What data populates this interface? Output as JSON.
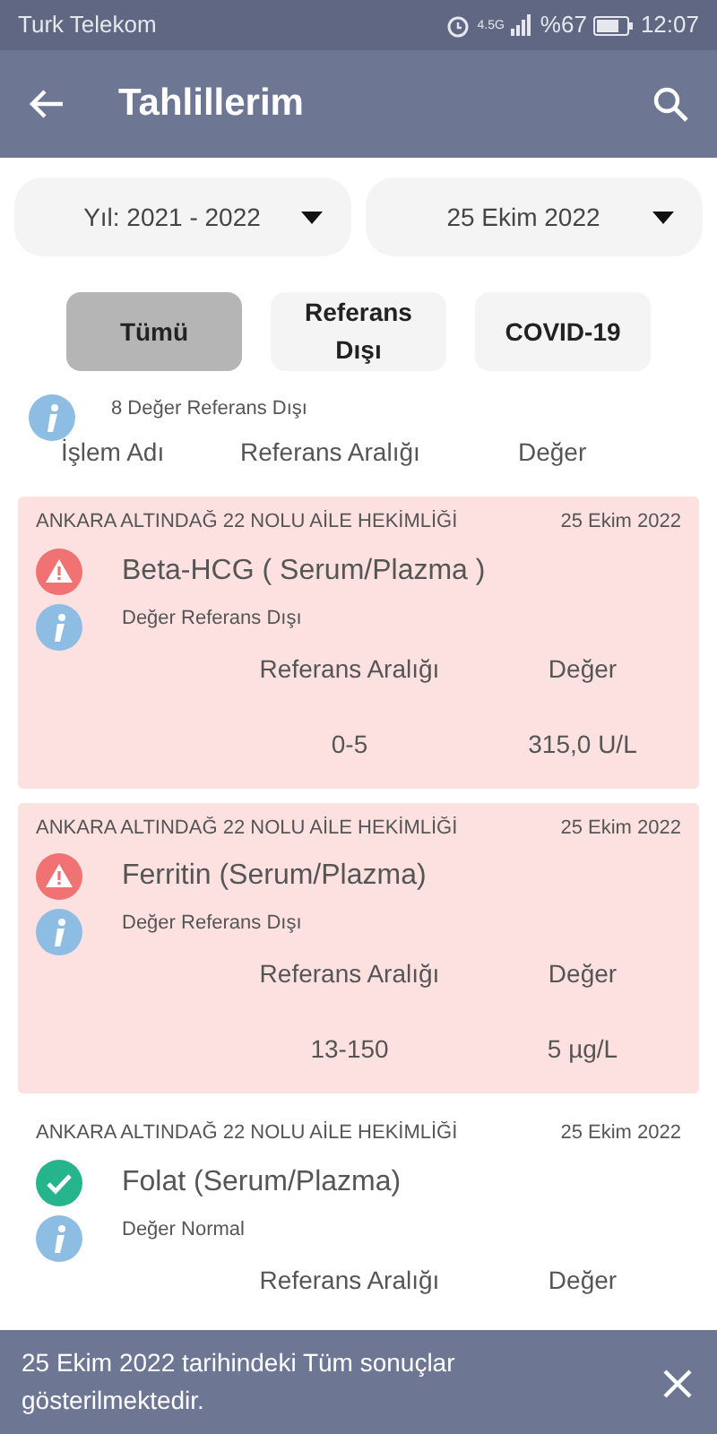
{
  "status_bar": {
    "carrier": "Turk Telekom",
    "network": "4.5G",
    "battery": "%67",
    "time": "12:07"
  },
  "app_bar": {
    "title": "Tahlillerim"
  },
  "dropdowns": [
    {
      "value": "Yıl: 2021 - 2022"
    },
    {
      "value": "25 Ekim 2022"
    }
  ],
  "filters": [
    {
      "label": "Tümü",
      "selected": true
    },
    {
      "label": "Referans Dışı",
      "selected": false
    },
    {
      "label": "COVID-19",
      "selected": false
    }
  ],
  "summary": "8 Değer Referans Dışı",
  "columns": [
    "İşlem Adı",
    "Referans Aralığı",
    "Değer"
  ],
  "results": [
    {
      "kind": "out",
      "institution": "ANKARA ALTINDAĞ 22 NOLU AİLE HEKİMLİĞİ",
      "date": "25 Ekim 2022",
      "name": "Beta-HCG ( Serum/Plazma )",
      "note": "Değer Referans Dışı",
      "range_label": "Referans Aralığı",
      "value_label": "Değer",
      "range": "0-5",
      "value": "315,0 U/L"
    },
    {
      "kind": "out",
      "institution": "ANKARA ALTINDAĞ 22 NOLU AİLE HEKİMLİĞİ",
      "date": "25 Ekim 2022",
      "name": "Ferritin (Serum/Plazma)",
      "note": "Değer Referans Dışı",
      "range_label": "Referans Aralığı",
      "value_label": "Değer",
      "range": "13-150",
      "value": "5 µg/L"
    },
    {
      "kind": "normal",
      "institution": "ANKARA ALTINDAĞ 22 NOLU AİLE HEKİMLİĞİ",
      "date": "25 Ekim 2022",
      "name": "Folat (Serum/Plazma)",
      "note": "Değer Normal",
      "range_label": "Referans Aralığı",
      "value_label": "Değer"
    }
  ],
  "snackbar": {
    "message": "25 Ekim 2022 tarihindeki Tüm sonuçlar gösterilmektedir."
  }
}
